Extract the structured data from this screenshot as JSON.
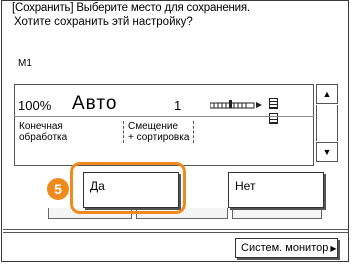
{
  "header": {
    "title_line": "[Сохранить] Выберите место для сохранения.",
    "question": "Хотите сохранить этй настройку?"
  },
  "memory_slot": "M1",
  "settings": {
    "zoom": "100%",
    "mode": "Авто",
    "copies": "1",
    "finishing_label_1": "Конечная",
    "finishing_label_2": "обработка",
    "finishing_value_1": "Смещение",
    "finishing_value_2": "+ сортировка"
  },
  "scroll": {
    "up": "▲",
    "down": "▼"
  },
  "dialog": {
    "yes_label": "Да",
    "no_label": "Нет"
  },
  "step_number": "5",
  "footer": {
    "system_monitor_label": "Систем. монитор"
  },
  "colors": {
    "highlight": "#f08a1c"
  }
}
